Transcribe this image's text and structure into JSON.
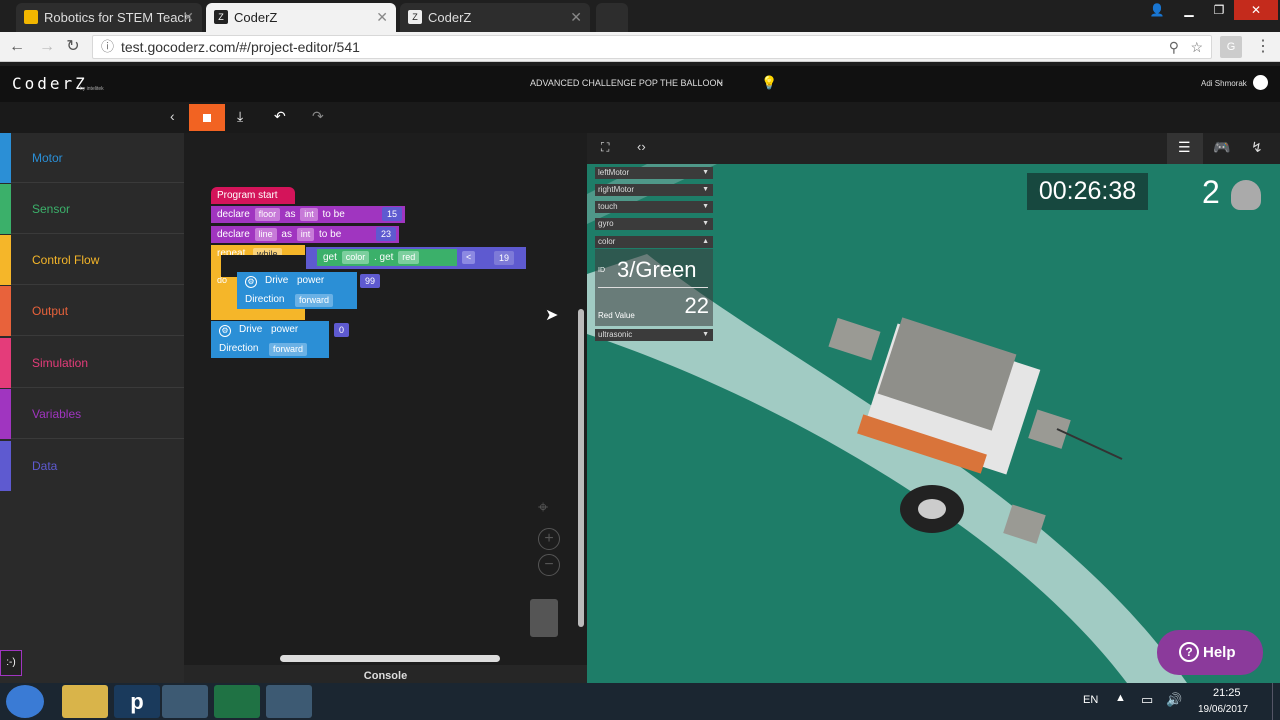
{
  "browser": {
    "tabs": [
      {
        "title": "Robotics for STEM Teach",
        "active": false
      },
      {
        "title": "CoderZ",
        "active": true
      },
      {
        "title": "CoderZ",
        "active": false
      }
    ],
    "url": "test.gocoderz.com/#/project-editor/541"
  },
  "app": {
    "logo": "CoderZ",
    "logo_sub": "by intelitek",
    "challenge": "ADVANCED CHALLENGE POP THE BALLOON",
    "user": "Adi Shmorak"
  },
  "sidebar": {
    "items": [
      {
        "label": "Motor",
        "color": "#2b8fd6"
      },
      {
        "label": "Sensor",
        "color": "#3bb06a"
      },
      {
        "label": "Control Flow",
        "color": "#f5b629"
      },
      {
        "label": "Output",
        "color": "#e8623b"
      },
      {
        "label": "Simulation",
        "color": "#e43c7a"
      },
      {
        "label": "Variables",
        "color": "#a035c0"
      },
      {
        "label": "Data",
        "color": "#5e5ad0"
      }
    ],
    "smiley": ":-)"
  },
  "blocks": {
    "program_start": "Program start",
    "declare1": {
      "kw": "declare",
      "var": "floor",
      "as": "as",
      "type": "int",
      "tobe": "to be",
      "value": "15"
    },
    "declare2": {
      "kw": "declare",
      "var": "line",
      "as": "as",
      "type": "int",
      "tobe": "to be",
      "value": "23"
    },
    "repeat": {
      "kw": "repeat",
      "mode": "while",
      "do": "do"
    },
    "condition": {
      "get1": "get",
      "sensor": "color",
      "dot": ".",
      "get2": "get",
      "prop": "red",
      "op": "<",
      "value": "19"
    },
    "drive1": {
      "label": "Drive",
      "power": "power",
      "value": "99",
      "direction": "Direction",
      "dir_value": "forward"
    },
    "drive2": {
      "label": "Drive",
      "power": "power",
      "value": "0",
      "direction": "Direction",
      "dir_value": "forward"
    }
  },
  "console": {
    "label": "Console"
  },
  "simulator": {
    "timer": "00:26:38",
    "score": "2",
    "sensors": [
      {
        "label": "leftMotor"
      },
      {
        "label": "rightMotor"
      },
      {
        "label": "touch"
      },
      {
        "label": "gyro"
      }
    ],
    "color_panel": {
      "label": "color",
      "id_label": "ID",
      "id_value": "3/Green",
      "red_label": "Red Value",
      "red_value": "22"
    },
    "ultrasonic": "ultrasonic",
    "help": "Help"
  },
  "taskbar": {
    "lang": "EN",
    "time": "21:25",
    "date": "19/06/2017"
  }
}
